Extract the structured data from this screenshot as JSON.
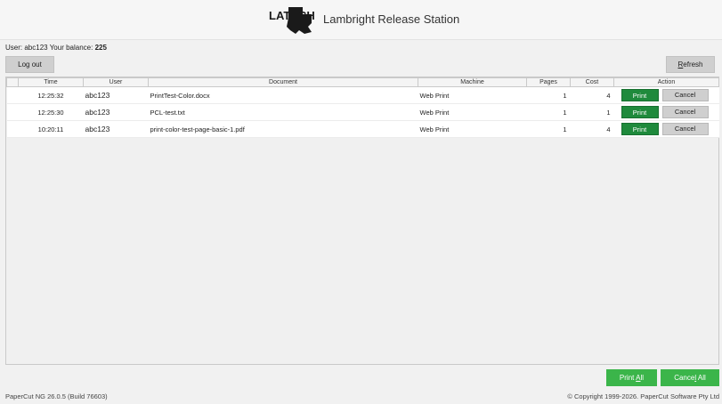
{
  "header": {
    "logo_text": "LATECH",
    "title": "Lambright Release Station"
  },
  "user_info": {
    "user_label": "User:",
    "username": "abc123",
    "balance_label": "Your balance:",
    "balance": "225"
  },
  "buttons": {
    "logout": "Log out",
    "refresh_underlined": "R",
    "refresh_rest": "efresh",
    "print_all_prefix": "Print ",
    "print_all_underlined": "A",
    "print_all_rest": "ll",
    "cancel_all_prefix": "Cance",
    "cancel_all_underlined": "l",
    "cancel_all_rest": " All"
  },
  "table": {
    "headers": [
      "Time",
      "User",
      "Document",
      "Machine",
      "Pages",
      "Cost",
      "Action"
    ],
    "rows": [
      {
        "time": "12:25:32",
        "user": "abc123",
        "document": "PrintTest-Color.docx",
        "machine": "Web Print",
        "pages": "1",
        "cost": "4",
        "print": "Print",
        "cancel": "Cancel"
      },
      {
        "time": "12:25:30",
        "user": "abc123",
        "document": "PCL-test.txt",
        "machine": "Web Print",
        "pages": "1",
        "cost": "1",
        "print": "Print",
        "cancel": "Cancel"
      },
      {
        "time": "10:20:11",
        "user": "abc123",
        "document": "print-color-test-page-basic-1.pdf",
        "machine": "Web Print",
        "pages": "1",
        "cost": "4",
        "print": "Print",
        "cancel": "Cancel"
      }
    ]
  },
  "footer": {
    "version": "PaperCut NG  26.0.5 (Build 76603)",
    "copyright": "© Copyright 1999-2026. PaperCut Software Pty Ltd"
  },
  "colors": {
    "print_button": "#1f8a3c",
    "bulk_button": "#3bb54a",
    "gray_button": "#cfcfcf"
  }
}
